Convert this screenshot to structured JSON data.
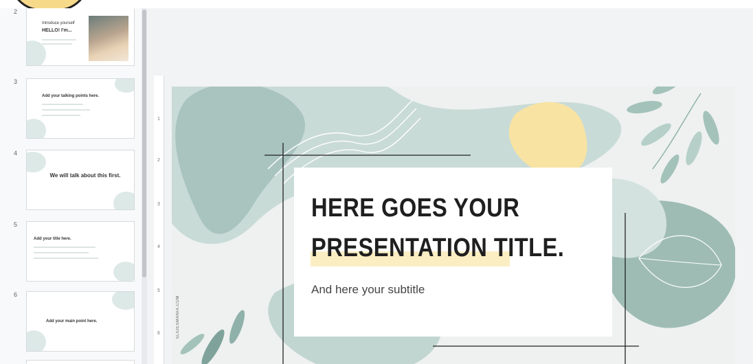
{
  "filmstrip": {
    "slides": [
      {
        "number": "2",
        "line1": "Introduce yourself",
        "line2": "HELLO! I'm..."
      },
      {
        "number": "3",
        "text": "Add your talking points here."
      },
      {
        "number": "4",
        "text": "We will talk about this first."
      },
      {
        "number": "5",
        "text": "Add your title here."
      },
      {
        "number": "6",
        "text": "Add your main point here."
      }
    ]
  },
  "ruler": {
    "marks": [
      "1",
      "2",
      "3",
      "4",
      "5",
      "6"
    ]
  },
  "slide": {
    "title_line1": "HERE GOES YOUR",
    "title_line2": "PRESENTATION TITLE.",
    "subtitle": "And here your subtitle",
    "credit": "SLIDESMANIA.COM"
  },
  "colors": {
    "sage": "#b7cdc8",
    "sage_dark": "#7fa39b",
    "yellow": "#f8e3a3",
    "highlight": "#fbeec3"
  }
}
